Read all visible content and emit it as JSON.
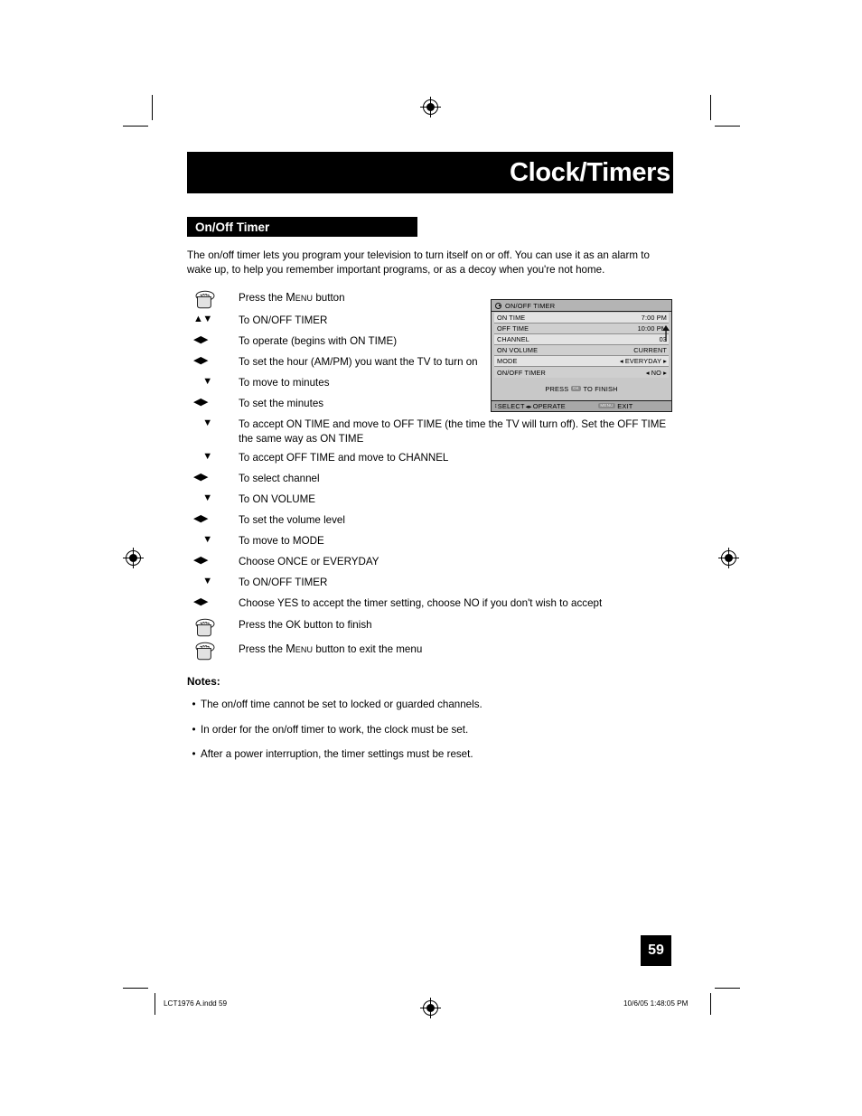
{
  "document": {
    "chapter_title": "Clock/Timers",
    "section_title": "On/Off Timer",
    "intro": "The on/off timer lets you program your television to turn itself on or off. You can use it as an alarm to wake up, to help you remember important programs, or as a decoy when you're not home.",
    "page_number": "59"
  },
  "steps": [
    {
      "key_type": "hand",
      "key_glyph": "",
      "text_prefix": "Press the ",
      "smallcaps": "Menu",
      "text_suffix": " button"
    },
    {
      "key_type": "arrows",
      "key_glyph": "▲▼",
      "text": "To ON/OFF TIMER"
    },
    {
      "key_type": "arrows",
      "key_glyph": "◀▶",
      "text": "To operate (begins with ON TIME)"
    },
    {
      "key_type": "arrows",
      "key_glyph": "◀▶",
      "text": "To set the hour (AM/PM) you want the TV to turn on"
    },
    {
      "key_type": "arrows",
      "key_glyph": "▼",
      "text": "To move to minutes"
    },
    {
      "key_type": "arrows",
      "key_glyph": "◀▶",
      "text": "To set the minutes"
    },
    {
      "key_type": "arrows",
      "key_glyph": "▼",
      "text": "To accept ON TIME and move to OFF TIME (the time the TV will turn off). Set the OFF TIME the same way as ON TIME"
    },
    {
      "key_type": "arrows",
      "key_glyph": "▼",
      "text": "To accept OFF TIME and move to CHANNEL"
    },
    {
      "key_type": "arrows",
      "key_glyph": "◀▶",
      "text": "To select channel"
    },
    {
      "key_type": "arrows",
      "key_glyph": "▼",
      "text": "To ON VOLUME"
    },
    {
      "key_type": "arrows",
      "key_glyph": "◀▶",
      "text": "To set the volume level"
    },
    {
      "key_type": "arrows",
      "key_glyph": "▼",
      "text": "To move to MODE"
    },
    {
      "key_type": "arrows",
      "key_glyph": "◀▶",
      "text": "Choose ONCE or EVERYDAY"
    },
    {
      "key_type": "arrows",
      "key_glyph": "▼",
      "text": "To ON/OFF TIMER"
    },
    {
      "key_type": "arrows",
      "key_glyph": "◀▶",
      "text": "Choose YES to accept the timer setting, choose NO if you don't wish to accept"
    },
    {
      "key_type": "hand",
      "key_glyph": "",
      "text": "Press the OK button to finish"
    },
    {
      "key_type": "hand",
      "key_glyph": "",
      "text_prefix": "Press the ",
      "smallcaps": "Menu",
      "text_suffix": " button to exit the menu"
    }
  ],
  "notes": {
    "heading": "Notes:",
    "bullet": "•",
    "items": [
      "The on/off time cannot be set to locked or guarded channels.",
      "In order for the on/off timer to work, the clock must be set.",
      "After a power interruption, the timer settings must be reset."
    ]
  },
  "osd": {
    "title": "ON/OFF TIMER",
    "rows": [
      {
        "label": "ON TIME",
        "value": "7:00 PM"
      },
      {
        "label": "OFF TIME",
        "value": "10:00 PM"
      },
      {
        "label": "CHANNEL",
        "value": "03"
      },
      {
        "label": "ON VOLUME",
        "value": "CURRENT"
      },
      {
        "label": "MODE",
        "value": "◂ EVERYDAY ▸"
      },
      {
        "label": "ON/OFF TIMER",
        "value": "◂ NO ▸"
      }
    ],
    "finish_prefix": "PRESS",
    "finish_button": "OK",
    "finish_suffix": "TO FINISH",
    "bottom_select_glyph": "↕",
    "bottom_select": "SELECT",
    "bottom_operate_glyph": "◂▸",
    "bottom_operate": "OPERATE",
    "bottom_exit_button": "MENU",
    "bottom_exit": "EXIT"
  },
  "footer": {
    "file_slug": "LCT1976 A.indd   59",
    "timestamp": "10/6/05   1:48:05 PM"
  },
  "colors": {
    "bar_black": "#000000",
    "page_white": "#ffffff",
    "osd_body": "#c8c8c8",
    "osd_row_light": "#e3e3e3",
    "osd_row_dark": "#cfcfcf",
    "osd_bottom": "#a8a8a8"
  }
}
